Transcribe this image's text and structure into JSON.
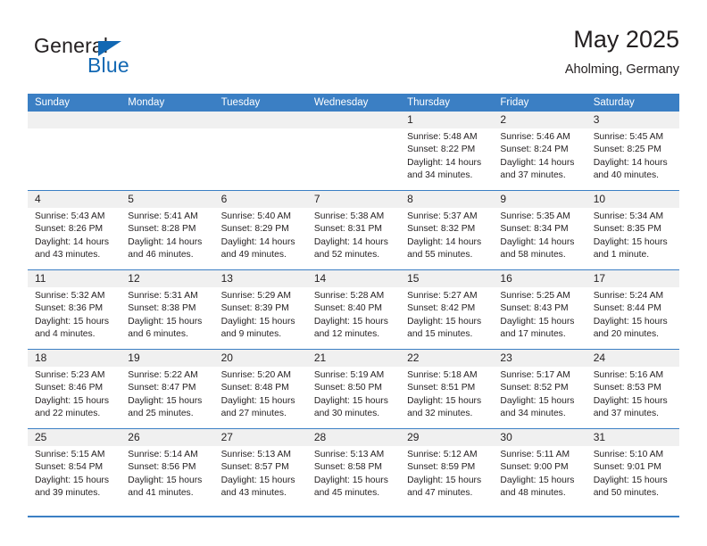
{
  "brand": {
    "name_top": "General",
    "name_bottom": "Blue",
    "triangle_color": "#1268b3",
    "text_color": "#231f20"
  },
  "header": {
    "title": "May 2025",
    "subtitle": "Aholming, Germany"
  },
  "theme": {
    "header_blue": "#3b7fc4",
    "cell_strip_gray": "#f0f0f0",
    "text": "#231f20"
  },
  "weekdays": [
    "Sunday",
    "Monday",
    "Tuesday",
    "Wednesday",
    "Thursday",
    "Friday",
    "Saturday"
  ],
  "weeks": [
    [
      {
        "day": "",
        "lines": []
      },
      {
        "day": "",
        "lines": []
      },
      {
        "day": "",
        "lines": []
      },
      {
        "day": "",
        "lines": []
      },
      {
        "day": "1",
        "lines": [
          "Sunrise: 5:48 AM",
          "Sunset: 8:22 PM",
          "Daylight: 14 hours and 34 minutes."
        ]
      },
      {
        "day": "2",
        "lines": [
          "Sunrise: 5:46 AM",
          "Sunset: 8:24 PM",
          "Daylight: 14 hours and 37 minutes."
        ]
      },
      {
        "day": "3",
        "lines": [
          "Sunrise: 5:45 AM",
          "Sunset: 8:25 PM",
          "Daylight: 14 hours and 40 minutes."
        ]
      }
    ],
    [
      {
        "day": "4",
        "lines": [
          "Sunrise: 5:43 AM",
          "Sunset: 8:26 PM",
          "Daylight: 14 hours and 43 minutes."
        ]
      },
      {
        "day": "5",
        "lines": [
          "Sunrise: 5:41 AM",
          "Sunset: 8:28 PM",
          "Daylight: 14 hours and 46 minutes."
        ]
      },
      {
        "day": "6",
        "lines": [
          "Sunrise: 5:40 AM",
          "Sunset: 8:29 PM",
          "Daylight: 14 hours and 49 minutes."
        ]
      },
      {
        "day": "7",
        "lines": [
          "Sunrise: 5:38 AM",
          "Sunset: 8:31 PM",
          "Daylight: 14 hours and 52 minutes."
        ]
      },
      {
        "day": "8",
        "lines": [
          "Sunrise: 5:37 AM",
          "Sunset: 8:32 PM",
          "Daylight: 14 hours and 55 minutes."
        ]
      },
      {
        "day": "9",
        "lines": [
          "Sunrise: 5:35 AM",
          "Sunset: 8:34 PM",
          "Daylight: 14 hours and 58 minutes."
        ]
      },
      {
        "day": "10",
        "lines": [
          "Sunrise: 5:34 AM",
          "Sunset: 8:35 PM",
          "Daylight: 15 hours and 1 minute."
        ]
      }
    ],
    [
      {
        "day": "11",
        "lines": [
          "Sunrise: 5:32 AM",
          "Sunset: 8:36 PM",
          "Daylight: 15 hours and 4 minutes."
        ]
      },
      {
        "day": "12",
        "lines": [
          "Sunrise: 5:31 AM",
          "Sunset: 8:38 PM",
          "Daylight: 15 hours and 6 minutes."
        ]
      },
      {
        "day": "13",
        "lines": [
          "Sunrise: 5:29 AM",
          "Sunset: 8:39 PM",
          "Daylight: 15 hours and 9 minutes."
        ]
      },
      {
        "day": "14",
        "lines": [
          "Sunrise: 5:28 AM",
          "Sunset: 8:40 PM",
          "Daylight: 15 hours and 12 minutes."
        ]
      },
      {
        "day": "15",
        "lines": [
          "Sunrise: 5:27 AM",
          "Sunset: 8:42 PM",
          "Daylight: 15 hours and 15 minutes."
        ]
      },
      {
        "day": "16",
        "lines": [
          "Sunrise: 5:25 AM",
          "Sunset: 8:43 PM",
          "Daylight: 15 hours and 17 minutes."
        ]
      },
      {
        "day": "17",
        "lines": [
          "Sunrise: 5:24 AM",
          "Sunset: 8:44 PM",
          "Daylight: 15 hours and 20 minutes."
        ]
      }
    ],
    [
      {
        "day": "18",
        "lines": [
          "Sunrise: 5:23 AM",
          "Sunset: 8:46 PM",
          "Daylight: 15 hours and 22 minutes."
        ]
      },
      {
        "day": "19",
        "lines": [
          "Sunrise: 5:22 AM",
          "Sunset: 8:47 PM",
          "Daylight: 15 hours and 25 minutes."
        ]
      },
      {
        "day": "20",
        "lines": [
          "Sunrise: 5:20 AM",
          "Sunset: 8:48 PM",
          "Daylight: 15 hours and 27 minutes."
        ]
      },
      {
        "day": "21",
        "lines": [
          "Sunrise: 5:19 AM",
          "Sunset: 8:50 PM",
          "Daylight: 15 hours and 30 minutes."
        ]
      },
      {
        "day": "22",
        "lines": [
          "Sunrise: 5:18 AM",
          "Sunset: 8:51 PM",
          "Daylight: 15 hours and 32 minutes."
        ]
      },
      {
        "day": "23",
        "lines": [
          "Sunrise: 5:17 AM",
          "Sunset: 8:52 PM",
          "Daylight: 15 hours and 34 minutes."
        ]
      },
      {
        "day": "24",
        "lines": [
          "Sunrise: 5:16 AM",
          "Sunset: 8:53 PM",
          "Daylight: 15 hours and 37 minutes."
        ]
      }
    ],
    [
      {
        "day": "25",
        "lines": [
          "Sunrise: 5:15 AM",
          "Sunset: 8:54 PM",
          "Daylight: 15 hours and 39 minutes."
        ]
      },
      {
        "day": "26",
        "lines": [
          "Sunrise: 5:14 AM",
          "Sunset: 8:56 PM",
          "Daylight: 15 hours and 41 minutes."
        ]
      },
      {
        "day": "27",
        "lines": [
          "Sunrise: 5:13 AM",
          "Sunset: 8:57 PM",
          "Daylight: 15 hours and 43 minutes."
        ]
      },
      {
        "day": "28",
        "lines": [
          "Sunrise: 5:13 AM",
          "Sunset: 8:58 PM",
          "Daylight: 15 hours and 45 minutes."
        ]
      },
      {
        "day": "29",
        "lines": [
          "Sunrise: 5:12 AM",
          "Sunset: 8:59 PM",
          "Daylight: 15 hours and 47 minutes."
        ]
      },
      {
        "day": "30",
        "lines": [
          "Sunrise: 5:11 AM",
          "Sunset: 9:00 PM",
          "Daylight: 15 hours and 48 minutes."
        ]
      },
      {
        "day": "31",
        "lines": [
          "Sunrise: 5:10 AM",
          "Sunset: 9:01 PM",
          "Daylight: 15 hours and 50 minutes."
        ]
      }
    ]
  ]
}
